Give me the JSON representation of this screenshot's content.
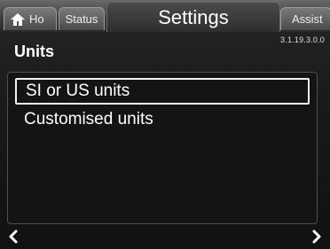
{
  "tabs": {
    "home": {
      "label": "Ho",
      "icon": "home-icon"
    },
    "status": {
      "label": "Status"
    },
    "active": {
      "label": "Settings"
    },
    "assist": {
      "label": "Assist"
    }
  },
  "version": "3.1.19.3.0.0",
  "page": {
    "title": "Units"
  },
  "menu": {
    "items": [
      {
        "label": "SI or US units",
        "selected": true
      },
      {
        "label": "Customised units",
        "selected": false
      }
    ]
  },
  "nav": {
    "left_icon": "chevron-left-icon",
    "right_icon": "chevron-right-icon"
  }
}
